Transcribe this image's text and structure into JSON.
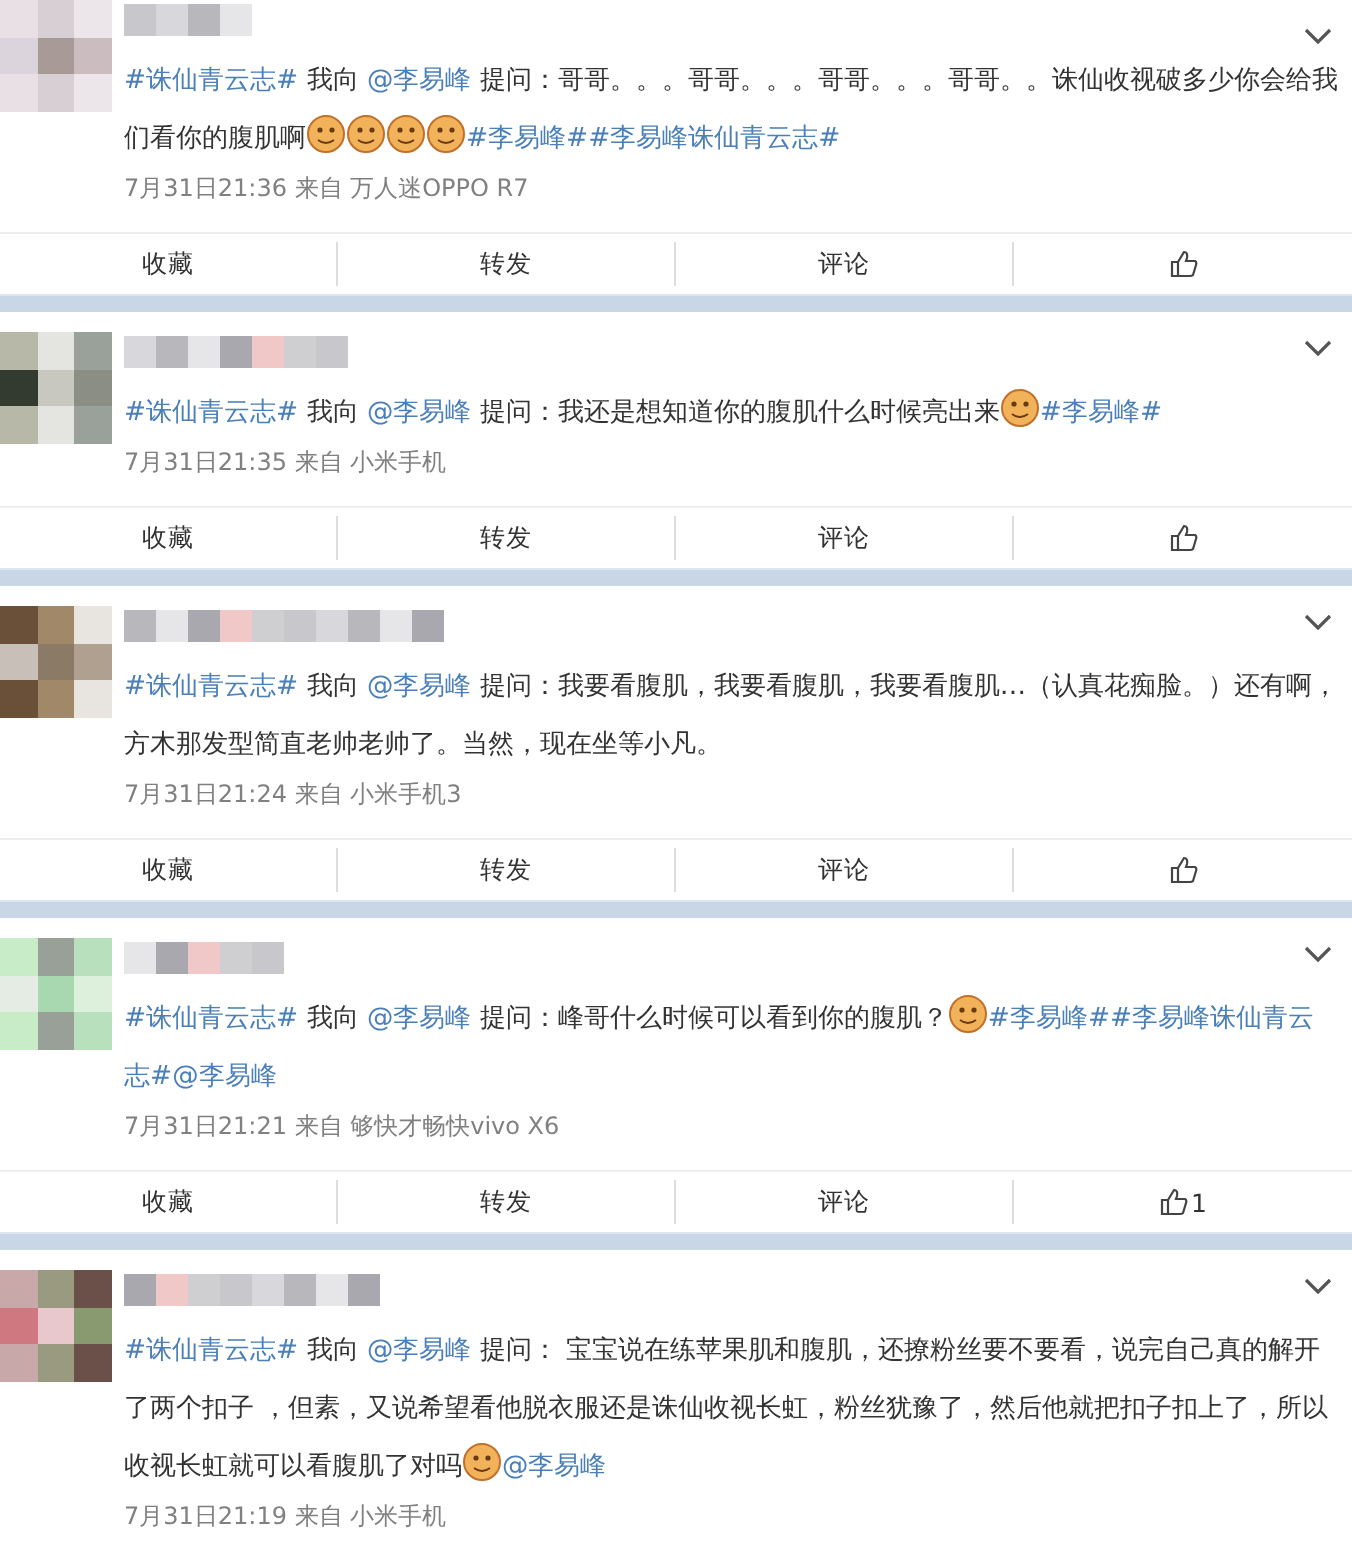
{
  "posts": [
    {
      "segments": [
        {
          "kind": "hashtag",
          "text": "#诛仙青云志#"
        },
        {
          "kind": "text",
          "text": " 我向 "
        },
        {
          "kind": "mention",
          "text": "@李易峰"
        },
        {
          "kind": "text",
          "text": " 提问：哥哥。。。哥哥。。。哥哥。。。哥哥。。诛仙收视破多少你会给我们看你的腹肌啊"
        },
        {
          "kind": "emoji"
        },
        {
          "kind": "emoji"
        },
        {
          "kind": "emoji"
        },
        {
          "kind": "emoji"
        },
        {
          "kind": "hashtag",
          "text": "#李易峰#"
        },
        {
          "kind": "hashtag",
          "text": "#李易峰诛仙青云志#"
        }
      ],
      "meta": "7月31日21:36 来自 万人迷OPPO R7",
      "actions": [
        "收藏",
        "转发",
        "评论"
      ]
    },
    {
      "segments": [
        {
          "kind": "hashtag",
          "text": "#诛仙青云志#"
        },
        {
          "kind": "text",
          "text": " 我向 "
        },
        {
          "kind": "mention",
          "text": "@李易峰"
        },
        {
          "kind": "text",
          "text": " 提问：我还是想知道你的腹肌什么时候亮出来"
        },
        {
          "kind": "emoji"
        },
        {
          "kind": "hashtag",
          "text": "#李易峰#"
        }
      ],
      "meta": "7月31日21:35 来自 小米手机",
      "actions": [
        "收藏",
        "转发",
        "评论"
      ]
    },
    {
      "segments": [
        {
          "kind": "hashtag",
          "text": "#诛仙青云志#"
        },
        {
          "kind": "text",
          "text": " 我向 "
        },
        {
          "kind": "mention",
          "text": "@李易峰"
        },
        {
          "kind": "text",
          "text": " 提问：我要看腹肌，我要看腹肌，我要看腹肌…（认真花痴脸。）还有啊，方木那发型简直老帅老帅了。当然，现在坐等小凡。"
        }
      ],
      "meta": "7月31日21:24 来自 小米手机3",
      "actions": [
        "收藏",
        "转发",
        "评论"
      ]
    },
    {
      "segments": [
        {
          "kind": "hashtag",
          "text": "#诛仙青云志#"
        },
        {
          "kind": "text",
          "text": " 我向 "
        },
        {
          "kind": "mention",
          "text": "@李易峰"
        },
        {
          "kind": "text",
          "text": " 提问：峰哥什么时候可以看到你的腹肌？"
        },
        {
          "kind": "emoji"
        },
        {
          "kind": "hashtag",
          "text": "#李易峰#"
        },
        {
          "kind": "hashtag",
          "text": "#李易峰诛仙青云志#"
        },
        {
          "kind": "mention",
          "text": "@李易峰"
        }
      ],
      "meta": "7月31日21:21 来自 够快才畅快vivo X6",
      "actions": [
        "收藏",
        "转发",
        "评论"
      ],
      "likes": "1"
    },
    {
      "segments": [
        {
          "kind": "hashtag",
          "text": "#诛仙青云志#"
        },
        {
          "kind": "text",
          "text": " 我向 "
        },
        {
          "kind": "mention",
          "text": "@李易峰"
        },
        {
          "kind": "text",
          "text": " 提问： 宝宝说在练苹果肌和腹肌，还撩粉丝要不要看，说完自己真的解开了两个扣子 ，但素，又说希望看他脱衣服还是诛仙收视长虹，粉丝犹豫了，然后他就把扣子扣上了，所以收视长虹就可以看腹肌了对吗"
        },
        {
          "kind": "emoji"
        },
        {
          "kind": "mention",
          "text": "@李易峰"
        }
      ],
      "meta": "7月31日21:19 来自 小米手机"
    }
  ]
}
